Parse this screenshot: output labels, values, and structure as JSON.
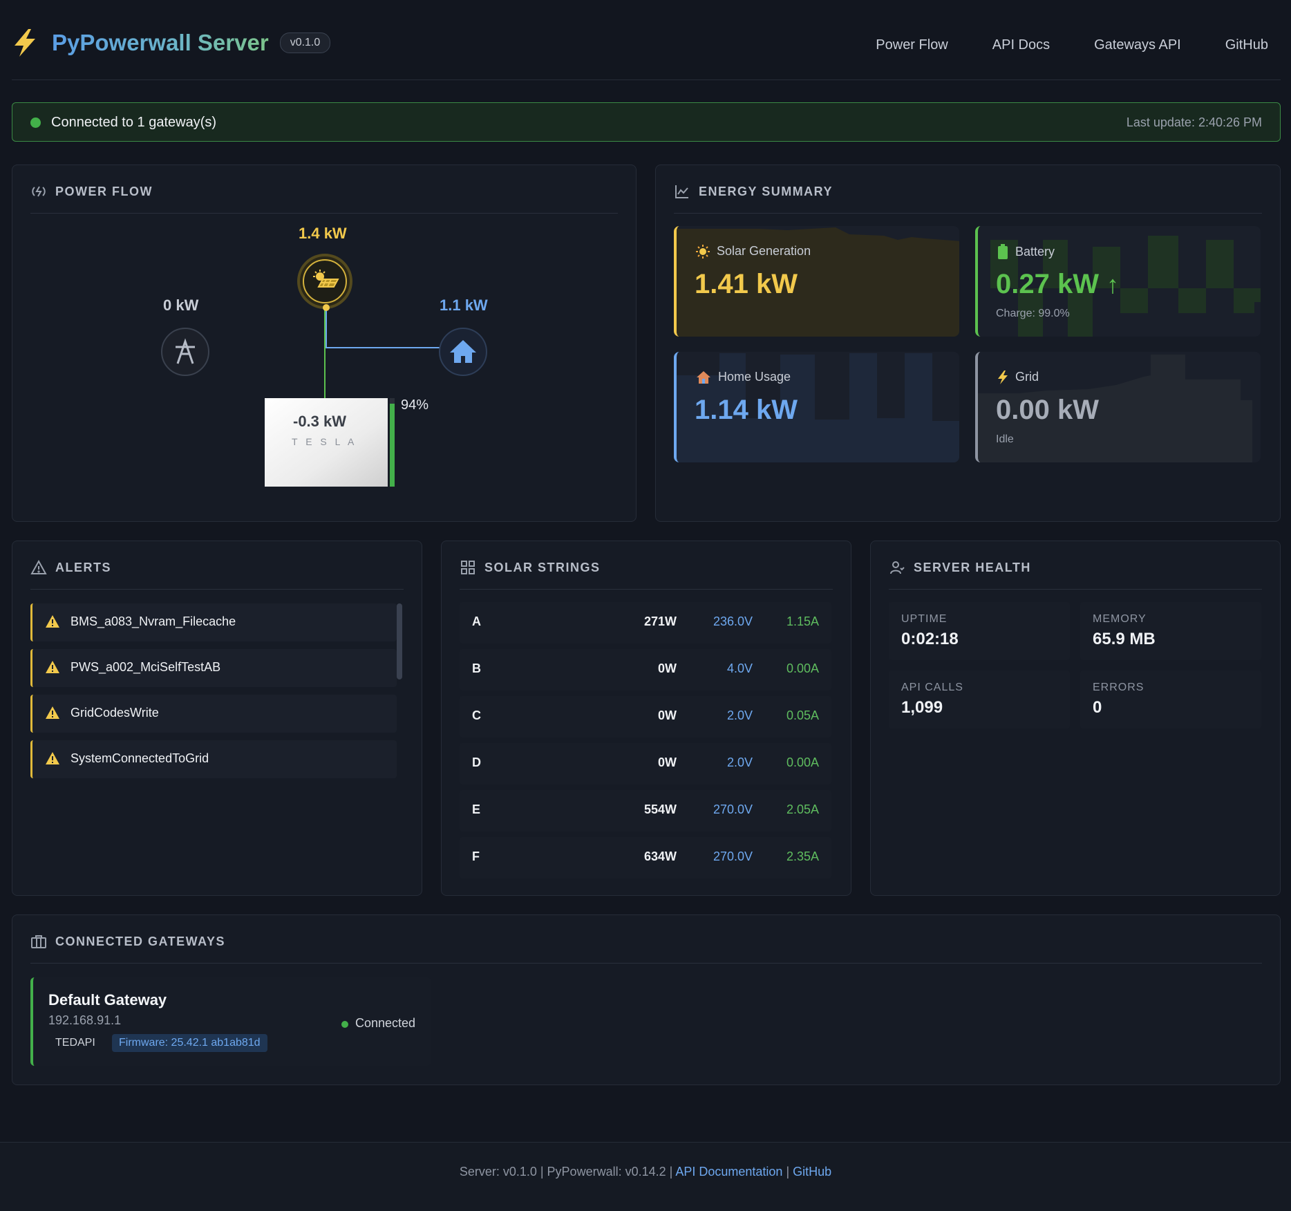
{
  "header": {
    "title": "PyPowerwall Server",
    "version": "v0.1.0",
    "nav": [
      "Power Flow",
      "API Docs",
      "Gateways API",
      "GitHub"
    ]
  },
  "status": {
    "text": "Connected to 1 gateway(s)",
    "last_update": "Last update: 2:40:26 PM",
    "color": "#43b04a"
  },
  "power_flow": {
    "title": "POWER FLOW",
    "solar": "1.4 kW",
    "grid": "0 kW",
    "home": "1.1 kW",
    "battery": "-0.3 kW",
    "battery_brand": "T E S L A",
    "battery_percent": "94%",
    "battery_level": 0.94
  },
  "energy_summary": {
    "title": "ENERGY SUMMARY",
    "solar": {
      "label": "Solar Generation",
      "value": "1.41 kW",
      "color": "#f2c94c"
    },
    "battery": {
      "label": "Battery",
      "value": "0.27 kW",
      "arrow": "↑",
      "sub": "Charge: 99.0%",
      "color": "#5cc24f"
    },
    "home": {
      "label": "Home Usage",
      "value": "1.14 kW",
      "color": "#6ea8ef"
    },
    "grid": {
      "label": "Grid",
      "value": "0.00 kW",
      "sub": "Idle",
      "color": "#a7adb8"
    }
  },
  "alerts": {
    "title": "ALERTS",
    "items": [
      "BMS_a083_Nvram_Filecache",
      "PWS_a002_MciSelfTestAB",
      "GridCodesWrite",
      "SystemConnectedToGrid"
    ]
  },
  "solar_strings": {
    "title": "SOLAR STRINGS",
    "rows": [
      {
        "name": "A",
        "power": "271W",
        "voltage": "236.0V",
        "current": "1.15A"
      },
      {
        "name": "B",
        "power": "0W",
        "voltage": "4.0V",
        "current": "0.00A"
      },
      {
        "name": "C",
        "power": "0W",
        "voltage": "2.0V",
        "current": "0.05A"
      },
      {
        "name": "D",
        "power": "0W",
        "voltage": "2.0V",
        "current": "0.00A"
      },
      {
        "name": "E",
        "power": "554W",
        "voltage": "270.0V",
        "current": "2.05A"
      },
      {
        "name": "F",
        "power": "634W",
        "voltage": "270.0V",
        "current": "2.35A"
      }
    ]
  },
  "server_health": {
    "title": "SERVER HEALTH",
    "uptime_label": "UPTIME",
    "uptime": "0:02:18",
    "memory_label": "MEMORY",
    "memory": "65.9 MB",
    "api_calls_label": "API CALLS",
    "api_calls": "1,099",
    "errors_label": "ERRORS",
    "errors": "0"
  },
  "gateways": {
    "title": "CONNECTED GATEWAYS",
    "items": [
      {
        "name": "Default Gateway",
        "ip": "192.168.91.1",
        "type": "TEDAPI",
        "firmware": "Firmware: 25.42.1 ab1ab81d",
        "status": "Connected"
      }
    ]
  },
  "footer": {
    "text": "Server: v0.1.0 | PyPowerwall: v0.14.2 |",
    "api_link": "API Documentation",
    "sep": "|",
    "github_link": "GitHub"
  }
}
